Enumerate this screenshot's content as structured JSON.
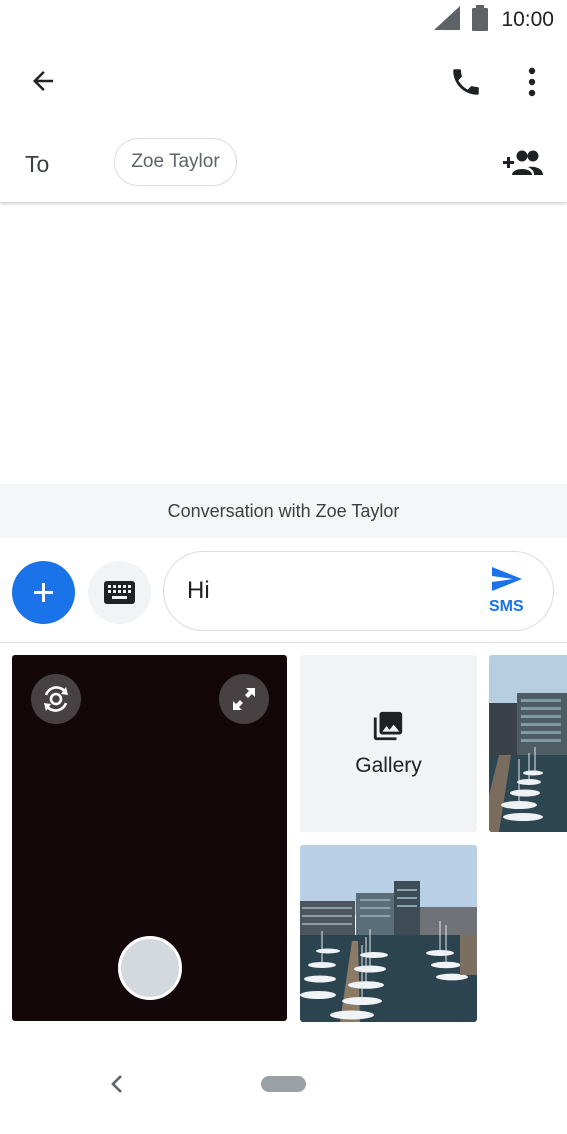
{
  "status_bar": {
    "time": "10:00"
  },
  "app_bar": {
    "back_icon": "arrow-back-icon",
    "call_icon": "phone-icon",
    "menu_icon": "more-vert-icon"
  },
  "recipients": {
    "to_label": "To",
    "chip_label": "Zoe Taylor",
    "add_people_icon": "add-people-icon"
  },
  "conversation": {
    "caption": "Conversation with Zoe Taylor"
  },
  "compose": {
    "add_icon": "plus-icon",
    "keyboard_icon": "keyboard-icon",
    "message_value": "Hi",
    "send_icon": "send-icon",
    "send_mode_label": "SMS"
  },
  "media_picker": {
    "camera_switch_icon": "camera-switch-icon",
    "fullscreen_icon": "fullscreen-icon",
    "gallery_icon": "photo-library-icon",
    "gallery_label": "Gallery"
  },
  "colors": {
    "accent": "#1a73e8",
    "camera_bg": "#130709",
    "tile_bg": "#f1f3f4"
  }
}
